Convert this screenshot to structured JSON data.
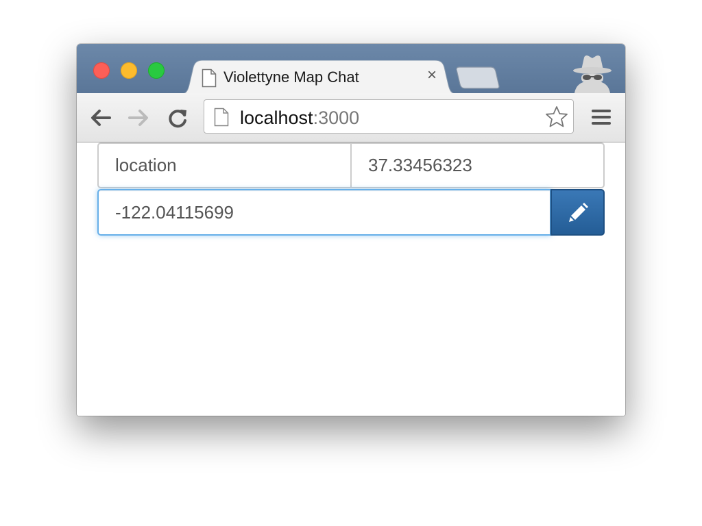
{
  "browser": {
    "tab_title": "Violettyne Map Chat",
    "tab_close_glyph": "×",
    "url_host": "localhost",
    "url_port": ":3000",
    "icons": {
      "back": "back-arrow-icon",
      "forward": "forward-arrow-icon",
      "reload": "reload-icon",
      "page": "page-icon",
      "bookmark": "star-icon",
      "menu": "hamburger-menu-icon",
      "incognito": "incognito-icon"
    },
    "colors": {
      "titlebar": "#5a7698",
      "traffic_close": "#fc5f57",
      "traffic_minimize": "#fdbc2e",
      "traffic_maximize": "#29c940"
    }
  },
  "form": {
    "location_value": "location",
    "latitude_value": "37.33456323",
    "longitude_value": "-122.04115699",
    "submit_icon": "pencil-icon",
    "colors": {
      "submit_button": "#2d6aa6",
      "focus_border": "#66afe9"
    }
  }
}
